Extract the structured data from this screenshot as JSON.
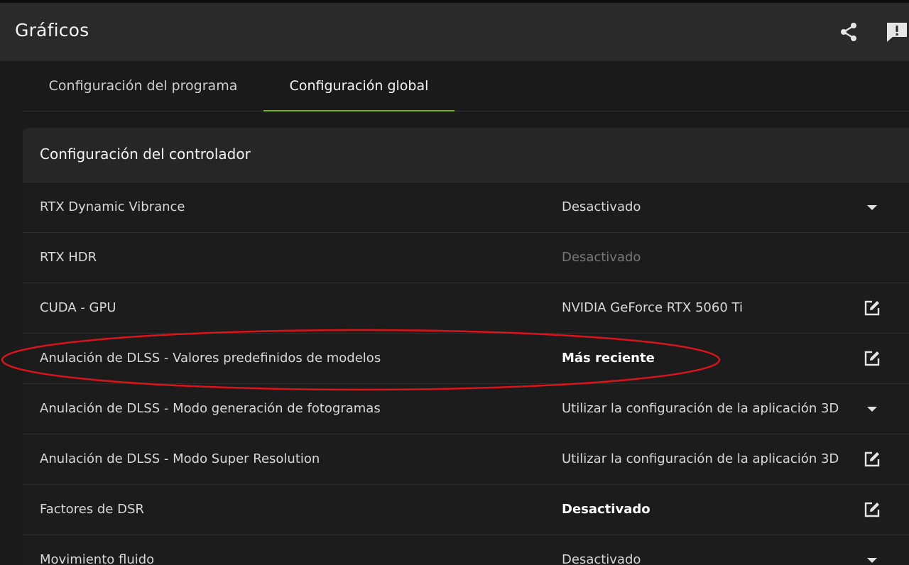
{
  "header": {
    "title": "Gráficos",
    "icons": [
      "share-icon",
      "feedback-icon"
    ]
  },
  "tabs": [
    {
      "label": "Configuración del programa",
      "active": false
    },
    {
      "label": "Configuración global",
      "active": true
    }
  ],
  "panel": {
    "title": "Configuración del controlador",
    "rows": [
      {
        "label": "RTX Dynamic Vibrance",
        "value": "Desactivado",
        "control": "dropdown"
      },
      {
        "label": "RTX HDR",
        "value": "Desactivado",
        "control": "none"
      },
      {
        "label": "CUDA - GPU",
        "value": "NVIDIA GeForce RTX 5060 Ti",
        "control": "edit"
      },
      {
        "label": "Anulación de DLSS - Valores predefinidos de modelos",
        "value": "Más reciente",
        "control": "edit"
      },
      {
        "label": "Anulación de DLSS - Modo generación de fotogramas",
        "value": "Utilizar la configuración de la aplicación 3D",
        "control": "dropdown"
      },
      {
        "label": "Anulación de DLSS - Modo Super Resolution",
        "value": "Utilizar la configuración de la aplicación 3D",
        "control": "edit"
      },
      {
        "label": "Factores de DSR",
        "value": "Desactivado",
        "control": "edit"
      },
      {
        "label": "Movimiento fluido",
        "value": "Desactivado",
        "control": "dropdown"
      }
    ]
  },
  "colors": {
    "accent": "#76b900",
    "annotation": "#d9141b"
  }
}
